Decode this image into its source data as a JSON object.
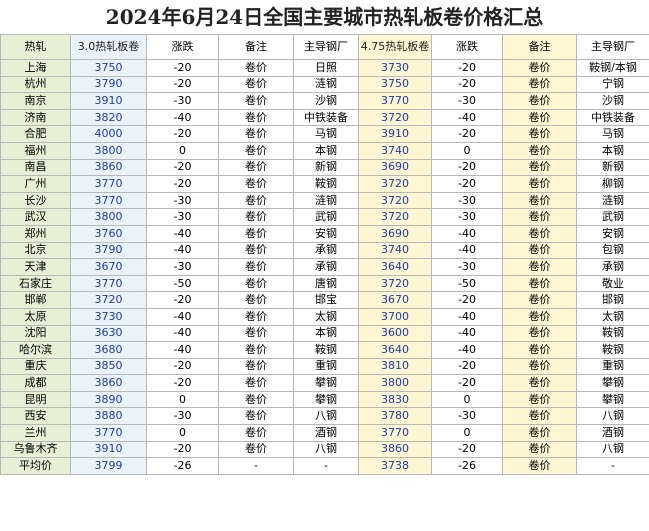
{
  "title": "2024年6月24日全国主要城市热轧板卷价格汇总",
  "headers": [
    "热轧",
    "3.0热轧板卷",
    "涨跌",
    "备注",
    "主导钢厂",
    "4.75热轧板卷",
    "涨跌",
    "备注",
    "主导钢厂"
  ],
  "rows": [
    [
      "上海",
      "3750",
      "-20",
      "卷价",
      "日照",
      "3730",
      "-20",
      "卷价",
      "鞍钢/本钢"
    ],
    [
      "杭州",
      "3790",
      "-20",
      "卷价",
      "涟钢",
      "3750",
      "-20",
      "卷价",
      "宁钢"
    ],
    [
      "南京",
      "3910",
      "-30",
      "卷价",
      "沙钢",
      "3770",
      "-30",
      "卷价",
      "沙钢"
    ],
    [
      "济南",
      "3820",
      "-40",
      "卷价",
      "中铁装备",
      "3720",
      "-40",
      "卷价",
      "中铁装备"
    ],
    [
      "合肥",
      "4000",
      "-20",
      "卷价",
      "马钢",
      "3910",
      "-20",
      "卷价",
      "马钢"
    ],
    [
      "福州",
      "3800",
      "0",
      "卷价",
      "本钢",
      "3740",
      "0",
      "卷价",
      "本钢"
    ],
    [
      "南昌",
      "3860",
      "-20",
      "卷价",
      "新钢",
      "3690",
      "-20",
      "卷价",
      "新钢"
    ],
    [
      "广州",
      "3770",
      "-20",
      "卷价",
      "鞍钢",
      "3720",
      "-20",
      "卷价",
      "柳钢"
    ],
    [
      "长沙",
      "3770",
      "-30",
      "卷价",
      "涟钢",
      "3720",
      "-30",
      "卷价",
      "涟钢"
    ],
    [
      "武汉",
      "3800",
      "-30",
      "卷价",
      "武钢",
      "3720",
      "-30",
      "卷价",
      "武钢"
    ],
    [
      "郑州",
      "3760",
      "-40",
      "卷价",
      "安钢",
      "3690",
      "-40",
      "卷价",
      "安钢"
    ],
    [
      "北京",
      "3790",
      "-40",
      "卷价",
      "承钢",
      "3740",
      "-40",
      "卷价",
      "包钢"
    ],
    [
      "天津",
      "3670",
      "-30",
      "卷价",
      "承钢",
      "3640",
      "-30",
      "卷价",
      "承钢"
    ],
    [
      "石家庄",
      "3770",
      "-50",
      "卷价",
      "唐钢",
      "3720",
      "-50",
      "卷价",
      "敬业"
    ],
    [
      "邯郸",
      "3720",
      "-20",
      "卷价",
      "邯宝",
      "3670",
      "-20",
      "卷价",
      "邯钢"
    ],
    [
      "太原",
      "3730",
      "-40",
      "卷价",
      "太钢",
      "3700",
      "-40",
      "卷价",
      "太钢"
    ],
    [
      "沈阳",
      "3630",
      "-40",
      "卷价",
      "本钢",
      "3600",
      "-40",
      "卷价",
      "鞍钢"
    ],
    [
      "哈尔滨",
      "3680",
      "-40",
      "卷价",
      "鞍钢",
      "3640",
      "-40",
      "卷价",
      "鞍钢"
    ],
    [
      "重庆",
      "3850",
      "-20",
      "卷价",
      "重钢",
      "3810",
      "-20",
      "卷价",
      "重钢"
    ],
    [
      "成都",
      "3860",
      "-20",
      "卷价",
      "攀钢",
      "3800",
      "-20",
      "卷价",
      "攀钢"
    ],
    [
      "昆明",
      "3890",
      "0",
      "卷价",
      "攀钢",
      "3830",
      "0",
      "卷价",
      "攀钢"
    ],
    [
      "西安",
      "3880",
      "-30",
      "卷价",
      "八钢",
      "3780",
      "-30",
      "卷价",
      "八钢"
    ],
    [
      "兰州",
      "3770",
      "0",
      "卷价",
      "酒钢",
      "3770",
      "0",
      "卷价",
      "酒钢"
    ],
    [
      "乌鲁木齐",
      "3910",
      "-20",
      "卷价",
      "八钢",
      "3860",
      "-20",
      "卷价",
      "八钢"
    ],
    [
      "平均价",
      "3799",
      "-26",
      "-",
      "-",
      "3738",
      "-26",
      "卷价",
      "-"
    ]
  ]
}
